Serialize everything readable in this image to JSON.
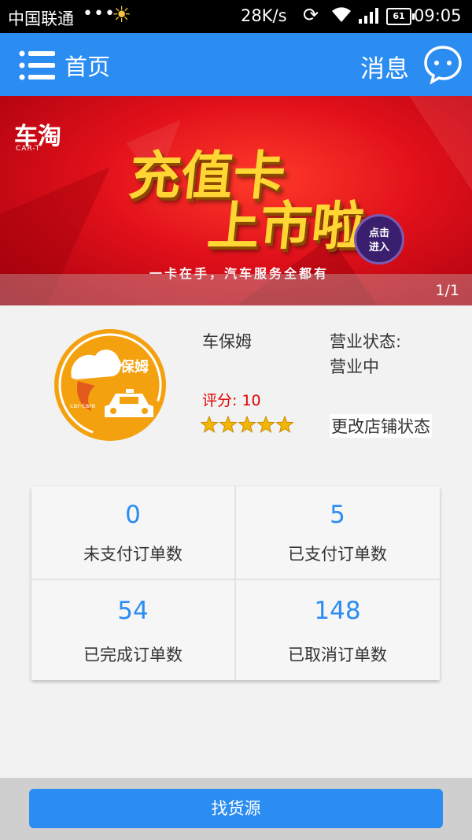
{
  "status_bar": {
    "carrier": "中国联通",
    "dots": "•••",
    "speed": "28K/s",
    "battery": "61",
    "time": "09:05",
    "icons": [
      "sun-icon",
      "sync-icon",
      "wifi-icon",
      "signal-icon",
      "battery-icon"
    ]
  },
  "header": {
    "menu_icon": "menu-icon",
    "title": "首页",
    "messages_label": "消息",
    "chat_icon": "chat-icon",
    "bar_color": "#2b8cf2"
  },
  "banner": {
    "logo": "车淘",
    "logo_sub": "CAR-T",
    "headline_line1": "充值卡",
    "headline_line2": "上市啦",
    "enter_badge": "点击\n进入",
    "slogan": "一卡在手，汽车服务全都有",
    "pager": "1/1"
  },
  "shop": {
    "logo_text": "车保姆",
    "logo_sub": "car-care",
    "name": "车保姆",
    "status_label": "营业状态:",
    "status_value": "营业中",
    "score": "评分: 10",
    "rating_stars": 5,
    "rating_max": 5,
    "change_status_label": "更改店铺状态"
  },
  "stats": [
    {
      "value": "0",
      "label": "未支付订单数"
    },
    {
      "value": "5",
      "label": "已支付订单数"
    },
    {
      "value": "54",
      "label": "已完成订单数"
    },
    {
      "value": "148",
      "label": "已取消订单数"
    }
  ],
  "footer": {
    "find_supply_label": "找货源"
  },
  "colors": {
    "accent": "#2b8cf2",
    "score_red": "#e00000",
    "star_gold": "#f2b705",
    "logo_orange": "#f4a10f"
  }
}
